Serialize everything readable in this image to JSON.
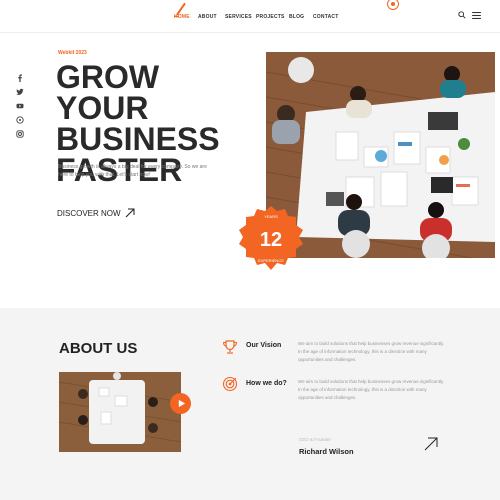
{
  "header": {
    "nav": [
      {
        "label": "HOME",
        "active": true
      },
      {
        "label": "ABOUT"
      },
      {
        "label": "SERVICES"
      },
      {
        "label": "PROJECTS"
      },
      {
        "label": "BLOG"
      },
      {
        "label": "CONTACT"
      }
    ],
    "icons": [
      "logo-slash-icon",
      "notification-dot-icon",
      "search-icon",
      "menu-icon"
    ]
  },
  "social": [
    "facebook-icon",
    "twitter-icon",
    "youtube-icon",
    "dribbble-icon",
    "instagram-icon"
  ],
  "hero": {
    "kicker": "Webkit 2023",
    "title_line1": "GROW YOUR",
    "title_line2": "BUSINESS",
    "title_line3": "FASTER",
    "description": "Business growth is always a big deal for every company. So we are here to help you with that. Let's start now!",
    "cta": "DISCOVER NOW",
    "badge_number": "12",
    "badge_text": "YEARS EXPERIENCE"
  },
  "about": {
    "title": "ABOUT US",
    "features": [
      {
        "title": "Our Vision",
        "icon": "trophy-icon",
        "text": "We aim to build solutions that help businesses grow revenue significantly. In the age of information technology, this is a direction with many opportunities and challenges."
      },
      {
        "title": "How we do?",
        "icon": "target-icon",
        "text": "We aim to build solutions that help businesses grow revenue significantly. In the age of information technology, this is a direction with many opportunities and challenges."
      }
    ],
    "ceo_role": "CEO & Founder",
    "ceo_name": "Richard Wilson"
  },
  "colors": {
    "accent": "#f26522",
    "text": "#2a2a2a",
    "muted": "#999999",
    "section_bg": "#f4f4f4"
  }
}
